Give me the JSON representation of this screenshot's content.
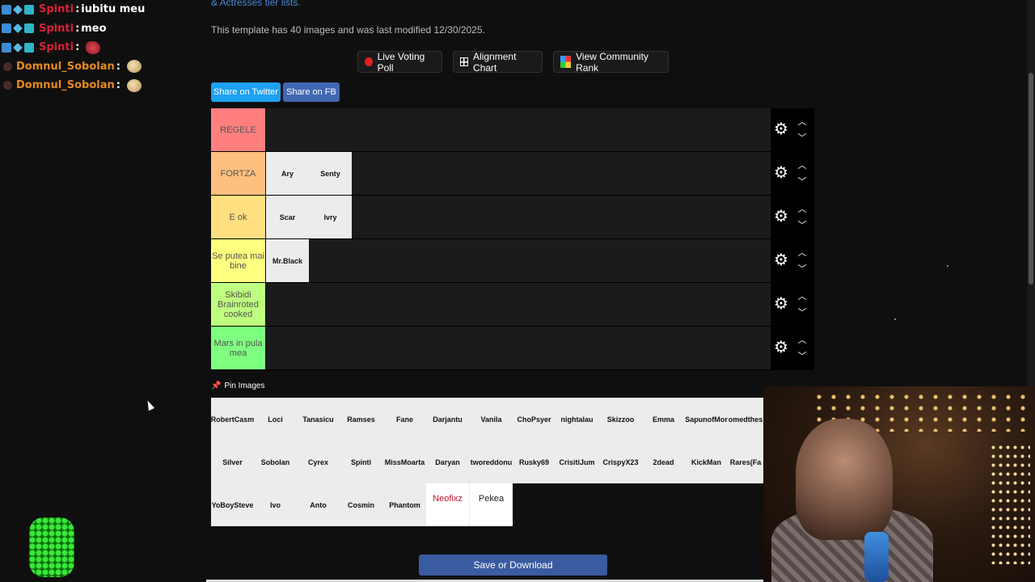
{
  "chat": [
    {
      "user": "Spinti",
      "text": "iubitu meu",
      "emote": ""
    },
    {
      "user": "Spinti",
      "text": "meo",
      "emote": ""
    },
    {
      "user": "Spinti",
      "text": "",
      "emote": "red-emote"
    },
    {
      "user": "Domnul_Sobolan",
      "text": "",
      "emote": "face-emote"
    },
    {
      "user": "Domnul_Sobolan",
      "text": "",
      "emote": "face-emote"
    }
  ],
  "page": {
    "top_link": "& Actresses tier lists.",
    "info": "This template has 40 images and was last modified 12/30/2025."
  },
  "buttons": {
    "live_voting": "Live Voting Poll",
    "alignment": "Alignment Chart",
    "community_rank": "View Community Rank",
    "share_twitter": "Share on Twitter",
    "share_fb": "Share on FB",
    "save": "Save or Download"
  },
  "tiers": [
    {
      "label": "REGELE",
      "color": "#ff7f7f",
      "items": []
    },
    {
      "label": "FORTZA",
      "color": "#ffbf7f",
      "items": [
        "Ary",
        "Senty"
      ]
    },
    {
      "label": "E ok",
      "color": "#ffdf7f",
      "items": [
        "Scar",
        "Ivry"
      ]
    },
    {
      "label": "Se putea mai bine",
      "color": "#ffff7f",
      "items": [
        "Mr.Black"
      ]
    },
    {
      "label": "Skibidi Brainroted cooked",
      "color": "#bfff7f",
      "items": []
    },
    {
      "label": "Mars in pula mea",
      "color": "#7fff7f",
      "items": []
    }
  ],
  "pin_label": "Pin Images",
  "pool_rows": [
    [
      "RobertCasm",
      "Loci",
      "Tanasicu",
      "Ramses",
      "Fane",
      "Darjantu",
      "Vanila",
      "ChoPsyer",
      "nightalau",
      "Skizzoo",
      "Emma",
      "SapunofMor",
      "omedthes"
    ],
    [
      "Silver",
      "Sobolan",
      "Cyrex",
      "Spinti",
      "MissMoarta",
      "Daryan",
      "tworeddonu",
      "Rusky69",
      "CrisitiJum",
      "CrispyX23",
      "2dead",
      "KickMan",
      "Rares(Fa"
    ],
    [
      "YoBoySteve",
      "Ivo",
      "Anto",
      "Cosmin",
      "Phantom",
      "Neofixz",
      "Pekea"
    ]
  ],
  "colors": {
    "twitter": "#1da1f2",
    "fb": "#4267b2",
    "save": "#3a5ba0",
    "neofixz": "#c8102e"
  }
}
